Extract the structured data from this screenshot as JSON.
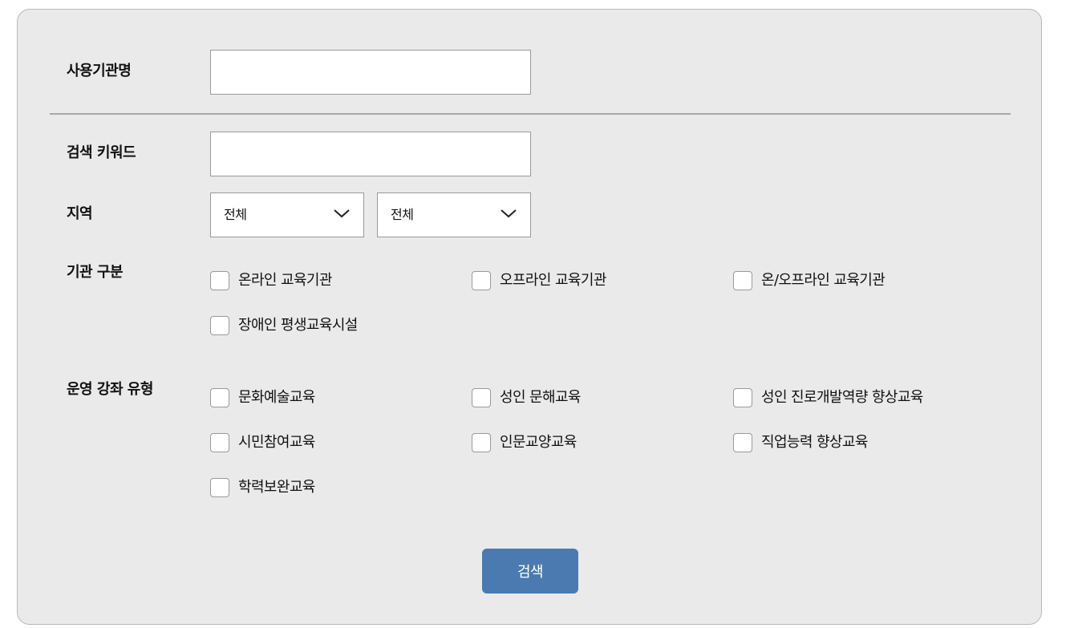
{
  "form": {
    "org_name": {
      "label": "사용기관명",
      "value": "",
      "placeholder": ""
    },
    "keyword": {
      "label": "검색 키워드",
      "value": "",
      "placeholder": ""
    },
    "region": {
      "label": "지역",
      "select1": "전체",
      "select2": "전체"
    },
    "org_type": {
      "label": "기관 구분",
      "options": [
        "온라인 교육기관",
        "오프라인 교육기관",
        "온/오프라인 교육기관",
        "장애인 평생교육시설"
      ]
    },
    "course_type": {
      "label": "운영 강좌 유형",
      "options": [
        "문화예술교육",
        "성인 문해교육",
        "성인 진로개발역량 향상교육",
        "시민참여교육",
        "인문교양교육",
        "직업능력 향상교육",
        "학력보완교육"
      ]
    },
    "search_button": "검색"
  },
  "colors": {
    "panel_bg": "#eaeaea",
    "button_bg": "#4a7ab0",
    "button_text": "#ffffff"
  },
  "icons": {
    "select_arrow": "chevron-down-icon"
  }
}
